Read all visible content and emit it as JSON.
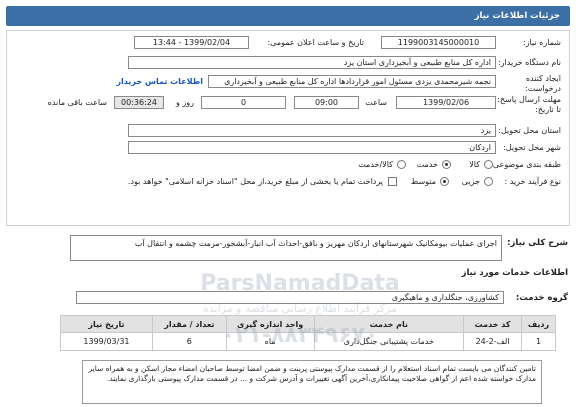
{
  "header": {
    "title": "جزئیات اطلاعات نیاز"
  },
  "need": {
    "number_label": "شماره نیاز:",
    "number": "1199003145000010",
    "announce_label": "تاریخ و ساعت اعلان عمومی:",
    "announce": "1399/02/04 - 13:44",
    "device_label": "نام دستگاه خریدار:",
    "device": "اداره کل منابع طبیعی و آبخیزداری استان یزد",
    "creator_label_1": "ایجاد کننده",
    "creator_label_2": "درخواست:",
    "creator": "نجمه شیرمحمدی یزدی مسئول امور قراردادها  اداره کل منابع طبیعی و آبخیزداری",
    "contact_link": "اطلاعات تماس خریدار",
    "deadline_label_1": "مهلت ارسال پاسخ:",
    "deadline_label_2": "تا تاریخ:",
    "deadline_date": "1399/02/06",
    "time_label": "ساعت",
    "deadline_time": "09:00",
    "day_count": "0",
    "day_label": "روز و",
    "remaining_time": "00:36:24",
    "remaining_label": "ساعت باقی مانده",
    "province_label": "استان محل تحویل:",
    "province": "یزد",
    "city_label": "شهر محل تحویل:",
    "city": "اردکان",
    "category_label": "طبقه بندی موضوعی:",
    "category_options": [
      "کالا",
      "خدمت",
      "کالا/خدمت"
    ],
    "category_selected": "خدمت",
    "process_label": "نوع فرآیند خرید :",
    "process_options": [
      "جزیی",
      "متوسط"
    ],
    "process_selected": "متوسط",
    "payment_text": "پرداخت تمام یا بخشی از مبلغ خرید،از محل \"اسناد خزانه اسلامی\" خواهد بود."
  },
  "summary": {
    "label": "شرح کلی نیاز:",
    "text": "اجرای عملیات بیومکانیک شهرستانهای اردکان مهریز و بافق-احداث آب انبار-آبشخور-مرمت چشمه و انتقال آب"
  },
  "services": {
    "section_title": "اطلاعات خدمات مورد نیاز",
    "group_label": "گروه خدمت:",
    "group": "کشاورزی، جنگلداری و ماهیگیری",
    "columns": [
      "ردیف",
      "کد خدمت",
      "نام خدمت",
      "واحد اندازه گیری",
      "تعداد / مقدار",
      "تاریخ نیاز"
    ],
    "rows": [
      [
        "1",
        "الف-2-24",
        "خدمات پشتیبانی جنگل‌داری",
        "ماه",
        "6",
        "1399/03/31"
      ]
    ]
  },
  "notes": {
    "text": "تامین کنندگان می بایست تمام اسناد استعلام را از قسمت مدارک پیوستی پرینت و ضمن امضا توسط صاحبان امضاء مجاز اسکن و به همراه سایر مدارک خواسته شده اعم از گواهی صلاحیت پیمانکاری،آخرین آگهی تغییرات و آدرس شرکت و ... در قسمت مدارک پیوستی بارگذاری نمایند."
  },
  "watermark": {
    "brand": "ParsNamadData",
    "line": "مرکز فرآیند اطلاع رسانی مناقصه و مزایده",
    "phone": "۰۲۱-۸۸۳۴۹۶۷۰"
  },
  "colors": {
    "header": "#3b6fa6",
    "link": "#1a56b8",
    "table_header": "#e2e2e2",
    "field_grey": "#e6e6e6"
  }
}
